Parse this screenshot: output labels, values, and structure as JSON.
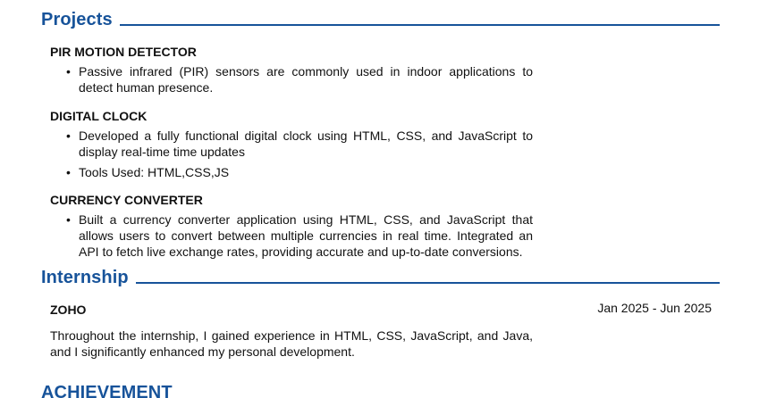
{
  "projects": {
    "heading": "Projects",
    "items": [
      {
        "title": "PIR MOTION DETECTOR",
        "bullets": [
          "Passive infrared (PIR) sensors are commonly used in indoor applications to detect human presence."
        ]
      },
      {
        "title": "DIGITAL CLOCK",
        "bullets": [
          "Developed a fully functional digital clock using HTML, CSS, and JavaScript to display real-time time updates",
          "Tools Used: HTML,CSS,JS"
        ]
      },
      {
        "title": "CURRENCY CONVERTER",
        "bullets": [
          "Built a currency converter application using HTML, CSS, and JavaScript that allows users to convert between multiple currencies in real time.  Integrated an API to fetch live exchange rates, providing accurate and up-to-date conversions."
        ]
      }
    ]
  },
  "internship": {
    "heading": "Internship",
    "company": "ZOHO",
    "date": "Jan 2025 - Jun 2025",
    "description": "Throughout the internship, I gained experience in HTML, CSS, JavaScript, and Java, and I significantly enhanced my personal development."
  },
  "achievement": {
    "heading": "ACHIEVEMENT"
  },
  "colors": {
    "accent": "#17539a",
    "text": "#111111"
  }
}
